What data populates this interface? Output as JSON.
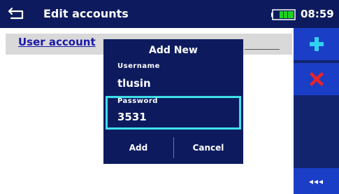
{
  "header": {
    "title": "Edit accounts",
    "time": "08:59",
    "back_icon": "back-arrow-icon",
    "battery_icon": "battery-icon",
    "battery_color": "#1fd11f"
  },
  "main": {
    "section_title": "User account"
  },
  "sidebar": {
    "add_icon": "plus-icon",
    "delete_icon": "x-icon",
    "more_label": "◂◂◂",
    "accent_color": "#1a3fc6",
    "delete_color": "#e8232a"
  },
  "dialog": {
    "title": "Add New",
    "username_label": "Username",
    "username_value": "tlusin",
    "password_label": "Password",
    "password_value": "3531",
    "add_label": "Add",
    "cancel_label": "Cancel",
    "focus_color": "#3fe0e8"
  }
}
